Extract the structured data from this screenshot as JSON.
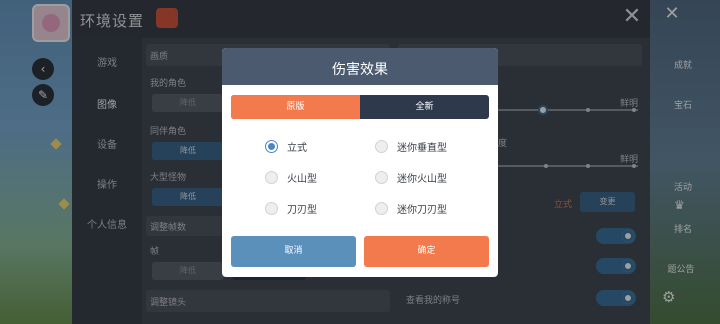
{
  "settings": {
    "title": "环境设置",
    "nav": [
      "游戏",
      "图像",
      "设备",
      "操作",
      "个人信息"
    ],
    "active_nav": "图像",
    "rows": {
      "quality": "画质",
      "my_character": "我的角色",
      "party_character": "同伴角色",
      "big_monster": "大型怪物",
      "adjust_frame": "调整帧数",
      "frame": "帧",
      "adjust_camera": "调整镜头",
      "show_my_title": "查看我的称号",
      "change_button": "变更",
      "style_value": "立式",
      "low_chip": "降低",
      "slider_right_label": "鲜明",
      "fragment_text": "度"
    }
  },
  "right_strip": {
    "labels": [
      "成就",
      "宝石",
      "活动",
      "排名",
      "题公告"
    ]
  },
  "modal": {
    "title": "伤害效果",
    "tabs": [
      {
        "label": "原版",
        "active": true
      },
      {
        "label": "全新",
        "active": false
      }
    ],
    "options": [
      {
        "label": "立式",
        "checked": true
      },
      {
        "label": "迷你垂直型",
        "checked": false
      },
      {
        "label": "火山型",
        "checked": false
      },
      {
        "label": "迷你火山型",
        "checked": false
      },
      {
        "label": "刀刃型",
        "checked": false
      },
      {
        "label": "迷你刀刃型",
        "checked": false
      }
    ],
    "cancel_label": "取消",
    "confirm_label": "确定"
  },
  "colors": {
    "accent_orange": "#f27a4c",
    "accent_blue": "#5b90bb",
    "header_slate": "#4c5a70",
    "tab_dark": "#2e3a4c"
  },
  "icons": [
    "close-icon",
    "back-chevron-icon",
    "trophy-icon",
    "gear-icon"
  ]
}
